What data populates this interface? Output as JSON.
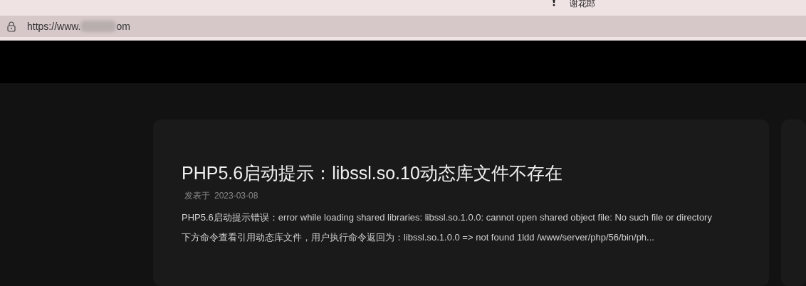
{
  "top_bar": {
    "user_name": "谢花郎"
  },
  "address_bar": {
    "url_start": "https://www.",
    "url_end": "om"
  },
  "post": {
    "title": "PHP5.6启动提示：libssl.so.10动态库文件不存在",
    "meta_label": "发表于",
    "date": "2023-03-08",
    "excerpt": "PHP5.6启动提示错误：error while loading shared libraries: libssl.so.1.0.0: cannot open shared object file: No such file or directory 下方命令查看引用动态库文件，用户执行命令返回为：libssl.so.1.0.0 => not found 1ldd /www/server/php/56/bin/ph..."
  }
}
